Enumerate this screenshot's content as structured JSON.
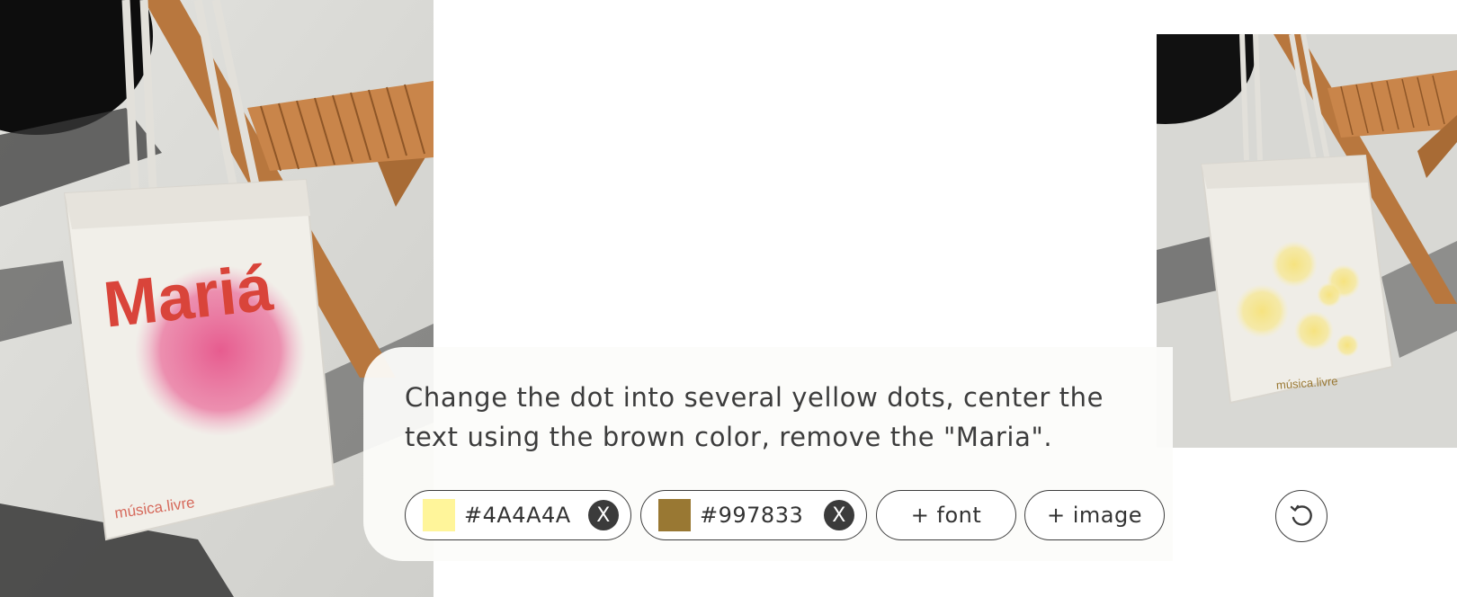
{
  "prompt": {
    "text": "Change the dot into several yellow dots, center the text using the brown color, remove the \"Maria\"."
  },
  "source_image": {
    "bag_title": "Mariá",
    "bag_brand": "música.livre"
  },
  "result_image": {
    "bag_brand": "música.livre"
  },
  "chips": {
    "color_1": {
      "hex": "#4A4A4A",
      "swatch": "#FFF59A",
      "remove_label": "X"
    },
    "color_2": {
      "hex": "#997833",
      "swatch": "#997833",
      "remove_label": "X"
    },
    "add_font": "+ font",
    "add_image": "+ image"
  },
  "icons": {
    "remove": "close-icon",
    "reset": "reset-icon"
  },
  "colors": {
    "bag_red": "#D9443A",
    "bag_pink": "#E8558A",
    "dot_yellow": "#F6E27A",
    "brown": "#997833",
    "chip_border": "#3D3D3D"
  }
}
